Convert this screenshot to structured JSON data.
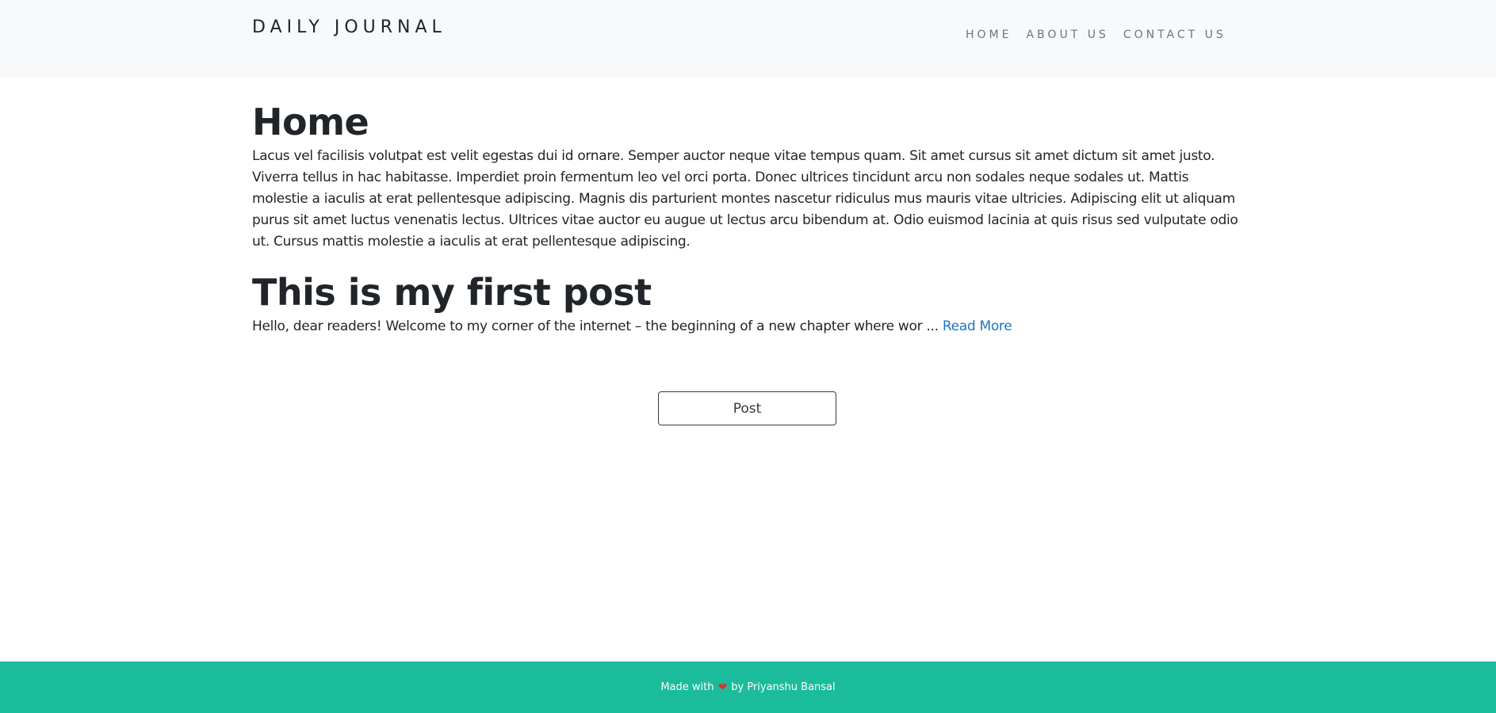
{
  "header": {
    "brand": "DAILY JOURNAL",
    "nav": [
      {
        "label": "HOME"
      },
      {
        "label": "ABOUT US"
      },
      {
        "label": "CONTACT US"
      }
    ]
  },
  "home": {
    "title": "Home",
    "body": "Lacus vel facilisis volutpat est velit egestas dui id ornare. Semper auctor neque vitae tempus quam. Sit amet cursus sit amet dictum sit amet justo. Viverra tellus in hac habitasse. Imperdiet proin fermentum leo vel orci porta. Donec ultrices tincidunt arcu non sodales neque sodales ut. Mattis molestie a iaculis at erat pellentesque adipiscing. Magnis dis parturient montes nascetur ridiculus mus mauris vitae ultricies. Adipiscing elit ut aliquam purus sit amet luctus venenatis lectus. Ultrices vitae auctor eu augue ut lectus arcu bibendum at. Odio euismod lacinia at quis risus sed vulputate odio ut. Cursus mattis molestie a iaculis at erat pellentesque adipiscing."
  },
  "posts": [
    {
      "title": "This is my first post",
      "excerpt": "Hello, dear readers! Welcome to my corner of the internet – the beginning of a new chapter where wor ...",
      "read_more": "Read More"
    }
  ],
  "actions": {
    "post_label": "Post"
  },
  "footer": {
    "made_with": "Made with",
    "heart_icon": "heart-icon",
    "by": "by Priyanshu Bansal"
  },
  "colors": {
    "navbar_bg": "#f8f9fa",
    "link": "#1a73c8",
    "footer_bg": "#1abc9c",
    "heart": "#e0302a"
  }
}
